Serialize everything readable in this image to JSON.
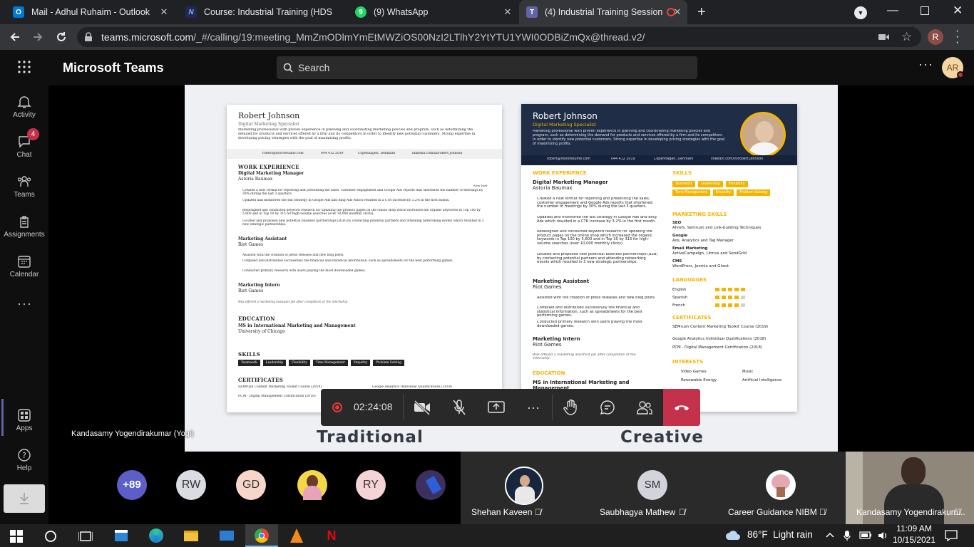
{
  "browser": {
    "tabs": [
      {
        "title": "Mail - Adhul Ruhaim - Outlook"
      },
      {
        "title": "Course: Industrial Training (HDSE"
      },
      {
        "title": "(9) WhatsApp"
      },
      {
        "title": "(4) Industrial Training Session"
      }
    ],
    "url_host": "teams.microsoft.com",
    "url_path": "/_#/calling/19:meeting_MmZmODlmYmEtMWZiOS00NzI2LTlhY2YtYTU1YWI0ODBiZmQx@thread.v2/",
    "profile_initial": "R"
  },
  "teams": {
    "app_title": "Microsoft Teams",
    "search_placeholder": "Search",
    "user_initials": "AR",
    "rail": [
      {
        "label": "Activity",
        "icon": "bell-icon"
      },
      {
        "label": "Chat",
        "icon": "chat-icon",
        "badge": "4"
      },
      {
        "label": "Teams",
        "icon": "teams-icon"
      },
      {
        "label": "Assignments",
        "icon": "assignments-icon"
      },
      {
        "label": "Calendar",
        "icon": "calendar-icon"
      },
      {
        "label": "Apps",
        "icon": "apps-icon"
      },
      {
        "label": "Help",
        "icon": "help-icon"
      }
    ]
  },
  "share": {
    "presenter": "Kandasamy Yogendirakumar (Yogi)",
    "label_left": "Traditional",
    "label_right": "Creative",
    "resume": {
      "name": "Robert Johnson",
      "role": "Digital Marketing Specialist",
      "summary": "Marketing professional with proven experience in planning and coordinating marketing policies and program, such as determining the demand for products and services offered by a firm and its competitors in order to identify new potential customers. Strong expertise in developing pricing strategies with the goal of maximizing profits.",
      "email": "robert@novoresume.com",
      "phone": "044 412 2019",
      "location": "Copenhagen, Denmark",
      "linkedin": "linkedin.com/in/robert.johnson",
      "work_title": "WORK EXPERIENCE",
      "job1_title": "Digital Marketing Manager",
      "job1_company": "Astoria Baumax",
      "job1_city": "New York",
      "job1_b1": "Created a new format for reporting and presenting the sales, customer engagement and Google Ads reports that shortened the number of meetings by 30% during the last 3 quarters.",
      "job1_b2": "Updated and monitored the Bid Strategy in Google Ads and Bing Ads which resulted in a CTR increase by 3.2% in the first month.",
      "job1_b3": "Redesigned and conducted keyword research for updating the product pages on the online shop which increased the organic keywords in Top 100 by 5,600 and in Top 10 by 315 for high-volume searches (over 10,000 monthly clicks).",
      "job1_b4": "Located and proposed new potential business partnerships (B2B) by contacting potential partners and attending networking events which resulted in 3 new strategic partnerships.",
      "job2_title": "Marketing Assistant",
      "job2_company": "Riot Games",
      "job2_b1": "Assisted with the creation of press releases and new blog posts.",
      "job2_b2": "Compiled and distributed successfully the financial and statistical information, such as spreadsheets for the best performing games.",
      "job2_b3": "Conducted primary research with users playing the most downloaded games.",
      "job3_title": "Marketing Intern",
      "job3_company": "Riot Games",
      "job3_note": "Was offered a marketing assistant job after completion of the internship.",
      "edu_title": "EDUCATION",
      "edu_degree": "MS in International Marketing and Management",
      "edu_school": "University of Chicago",
      "skills_title": "SKILLS",
      "skills": [
        "Teamwork",
        "Leadership",
        "Flexibility",
        "Time Management",
        "Empathy",
        "Problem Solving"
      ],
      "cert_title": "CERTIFICATES",
      "cert1": "SEMrush Content Marketing Toolkit Course (2019)",
      "cert2": "Google Analytics Individual Qualifications (2018)",
      "cert3": "PCM - Digital Management Certification (2018)",
      "mskills_title": "MARKETING SKILLS",
      "ms_seo": "SEO",
      "ms_seo_d": "Ahrefs, Semrush and Link-building Techniques",
      "ms_google": "Google",
      "ms_google_d": "Ads, Analytics and Tag Manager",
      "ms_email": "Email Marketing",
      "ms_email_d": "ActiveCampaign, Litmus and SendGrid",
      "ms_cms": "CMS",
      "ms_cms_d": "WordPress, Joomla and Ghost",
      "lang_title": "LANGUAGES",
      "lang_en": "English",
      "lang_es": "Spanish",
      "lang_fr": "French",
      "lang_en_level": 5,
      "lang_es_level": 4,
      "lang_fr_level": 4,
      "interests_title": "INTERESTS",
      "int1": "Video Games",
      "int2": "Music",
      "int3": "Renewable Energy",
      "int4": "Artificial Intelligence"
    }
  },
  "controls": {
    "call_timer": "02:24:08"
  },
  "participants": {
    "overflow": "+89",
    "avatars": [
      "RW",
      "GD",
      "RY"
    ],
    "tiles": [
      {
        "name": "Shehan Kaveen"
      },
      {
        "name": "Saubhagya Mathew",
        "initials": "SM"
      },
      {
        "name": "Career Guidance NIBM"
      },
      {
        "name": "Kandasamy Yogendirakum..."
      }
    ]
  },
  "taskbar": {
    "weather": "86°F  Light rain",
    "time": "11:09 AM",
    "date": "10/15/2021"
  },
  "colors": {
    "teams_accent": "#6264a7",
    "hangup_red": "#c4314b",
    "record_red": "#e53935",
    "creative_navy": "#1f2d47",
    "creative_yellow": "#f4b400"
  }
}
